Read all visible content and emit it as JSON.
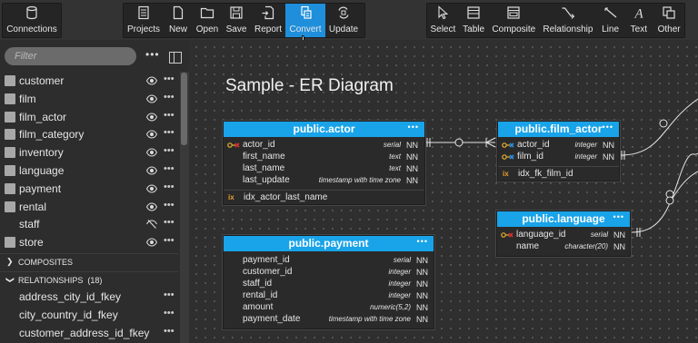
{
  "toolbar": {
    "connections": {
      "label": "Connections",
      "icon": "database-icon"
    },
    "project_group": [
      {
        "label": "Projects",
        "icon": "projects-icon"
      },
      {
        "label": "New",
        "icon": "new-file-icon"
      },
      {
        "label": "Open",
        "icon": "folder-icon"
      },
      {
        "label": "Save",
        "icon": "save-icon"
      },
      {
        "label": "Report",
        "icon": "report-icon"
      },
      {
        "label": "Convert",
        "icon": "convert-icon",
        "active": true
      },
      {
        "label": "Update",
        "icon": "update-icon"
      }
    ],
    "tools_group": [
      {
        "label": "Select",
        "icon": "pointer-icon"
      },
      {
        "label": "Table",
        "icon": "table-icon"
      },
      {
        "label": "Composite",
        "icon": "composite-icon"
      },
      {
        "label": "Relationship",
        "icon": "relationship-icon"
      },
      {
        "label": "Line",
        "icon": "line-icon"
      },
      {
        "label": "Text",
        "icon": "text-icon"
      },
      {
        "label": "Other",
        "icon": "other-icon"
      }
    ]
  },
  "sidebar": {
    "filter_placeholder": "Filter",
    "tables": [
      {
        "name": "customer",
        "visible": true
      },
      {
        "name": "film",
        "visible": true
      },
      {
        "name": "film_actor",
        "visible": true
      },
      {
        "name": "film_category",
        "visible": true
      },
      {
        "name": "inventory",
        "visible": true
      },
      {
        "name": "language",
        "visible": true
      },
      {
        "name": "payment",
        "visible": true
      },
      {
        "name": "rental",
        "visible": true
      },
      {
        "name": "staff",
        "visible": false
      },
      {
        "name": "store",
        "visible": true
      }
    ],
    "composites_label": "COMPOSITES",
    "relationships_label": "RELATIONSHIPS",
    "relationships_count": "(18)",
    "relationships": [
      "address_city_id_fkey",
      "city_country_id_fkey",
      "customer_address_id_fkey"
    ]
  },
  "canvas": {
    "title": "Sample - ER Diagram",
    "entities": {
      "actor": {
        "title": "public.actor",
        "columns": [
          {
            "name": "actor_id",
            "type": "serial",
            "nn": "NN",
            "pk": true
          },
          {
            "name": "first_name",
            "type": "text",
            "nn": "NN"
          },
          {
            "name": "last_name",
            "type": "text",
            "nn": "NN"
          },
          {
            "name": "last_update",
            "type": "timestamp with time zone",
            "nn": "NN"
          }
        ],
        "indexes": [
          "idx_actor_last_name"
        ]
      },
      "film_actor": {
        "title": "public.film_actor",
        "columns": [
          {
            "name": "actor_id",
            "type": "integer",
            "nn": "NN",
            "pk": true,
            "fk": true
          },
          {
            "name": "film_id",
            "type": "integer",
            "nn": "NN",
            "pk": true,
            "fk": true
          }
        ],
        "indexes": [
          "idx_fk_film_id"
        ]
      },
      "language": {
        "title": "public.language",
        "columns": [
          {
            "name": "language_id",
            "type": "serial",
            "nn": "NN",
            "pk": true
          },
          {
            "name": "name",
            "type": "character(20)",
            "nn": "NN"
          }
        ]
      },
      "payment": {
        "title": "public.payment",
        "columns": [
          {
            "name": "payment_id",
            "type": "serial",
            "nn": "NN"
          },
          {
            "name": "customer_id",
            "type": "integer",
            "nn": "NN"
          },
          {
            "name": "staff_id",
            "type": "integer",
            "nn": "NN"
          },
          {
            "name": "rental_id",
            "type": "integer",
            "nn": "NN"
          },
          {
            "name": "amount",
            "type": "numeric(5,2)",
            "nn": "NN"
          },
          {
            "name": "payment_date",
            "type": "timestamp with time zone",
            "nn": "NN"
          }
        ]
      }
    }
  },
  "colors": {
    "accent": "#1f8fdb",
    "entity_header": "#19a3e8",
    "pk_key": "#e8b030",
    "fk_key": "#d83030"
  }
}
